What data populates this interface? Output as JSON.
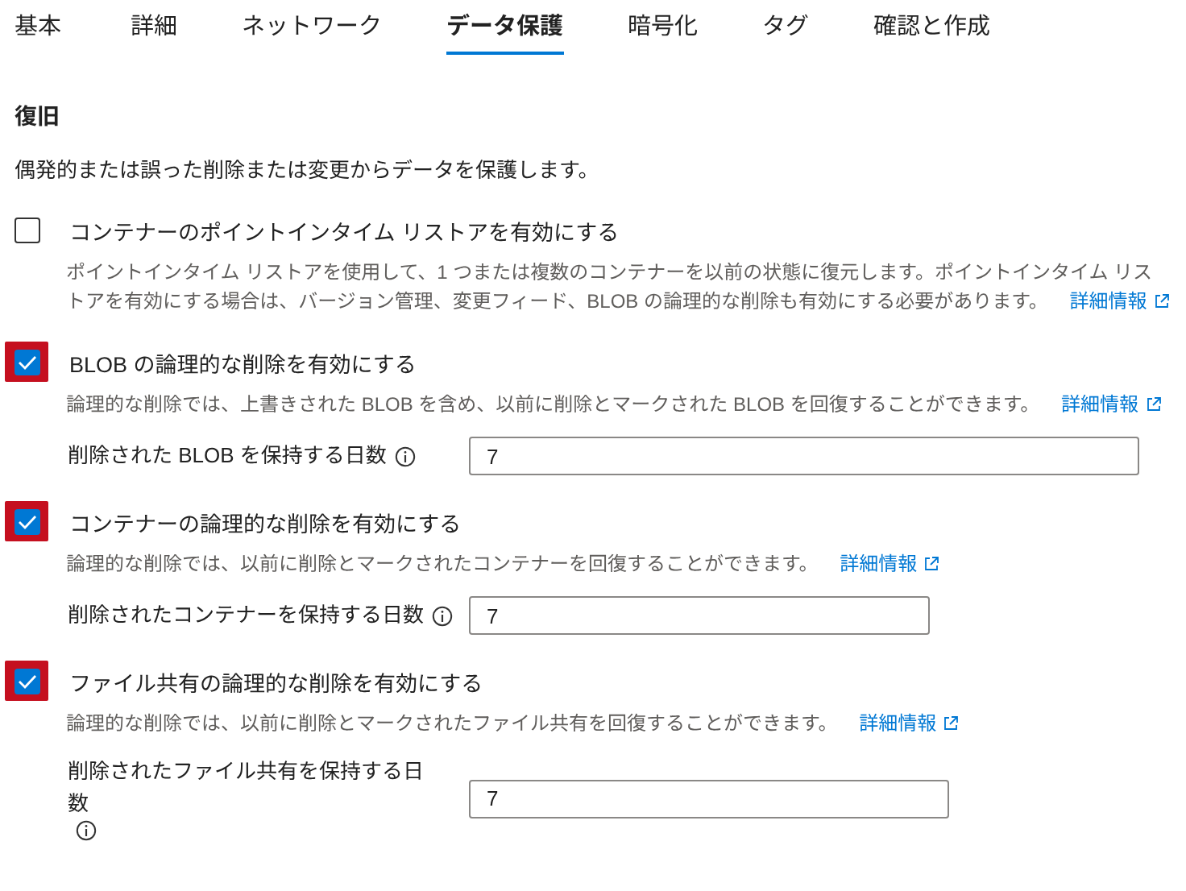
{
  "tabs": [
    {
      "label": "基本",
      "selected": false
    },
    {
      "label": "詳細",
      "selected": false
    },
    {
      "label": "ネットワーク",
      "selected": false
    },
    {
      "label": "データ保護",
      "selected": true
    },
    {
      "label": "暗号化",
      "selected": false
    },
    {
      "label": "タグ",
      "selected": false
    },
    {
      "label": "確認と作成",
      "selected": false
    }
  ],
  "section": {
    "title": "復旧",
    "description": "偶発的または誤った削除または変更からデータを保護します。"
  },
  "options": [
    {
      "label": "コンテナーのポイントインタイム リストアを有効にする",
      "checked": false,
      "highlighted": false,
      "description": "ポイントインタイム リストアを使用して、1 つまたは複数のコンテナーを以前の状態に復元します。ポイントインタイム リストアを有効にする場合は、バージョン管理、変更フィード、BLOB の論理的な削除も有効にする必要があります。",
      "link": "詳細情報"
    },
    {
      "label": "BLOB の論理的な削除を有効にする",
      "checked": true,
      "highlighted": true,
      "description": "論理的な削除では、上書きされた BLOB を含め、以前に削除とマークされた BLOB を回復することができます。",
      "link": "詳細情報",
      "field": {
        "label": "削除された BLOB を保持する日数",
        "value": "7"
      }
    },
    {
      "label": "コンテナーの論理的な削除を有効にする",
      "checked": true,
      "highlighted": true,
      "description": "論理的な削除では、以前に削除とマークされたコンテナーを回復することができます。",
      "link": "詳細情報",
      "field": {
        "label": "削除されたコンテナーを保持する日数",
        "value": "7"
      }
    },
    {
      "label": "ファイル共有の論理的な削除を有効にする",
      "checked": true,
      "highlighted": true,
      "description": "論理的な削除では、以前に削除とマークされたファイル共有を回復することができます。",
      "link": "詳細情報",
      "field": {
        "label": "削除されたファイル共有を保持する日数",
        "value": "7"
      }
    }
  ]
}
